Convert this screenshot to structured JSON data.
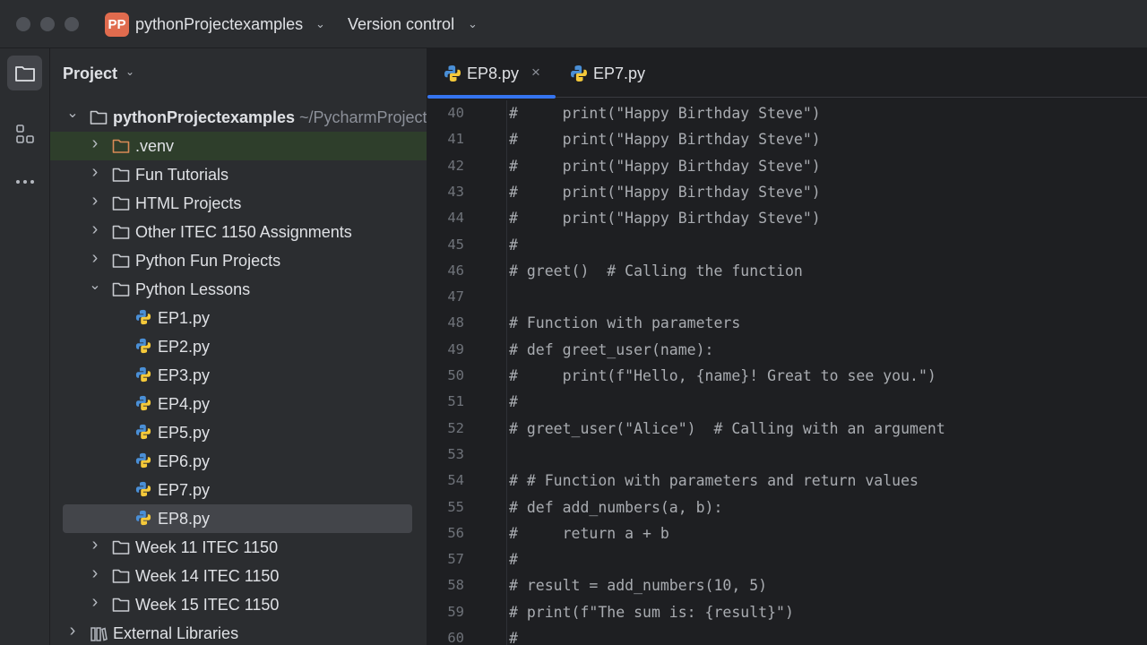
{
  "titlebar": {
    "project_badge": "PP",
    "project_name": "pythonProjectexamples",
    "vcs_label": "Version control"
  },
  "project_panel": {
    "header": "Project",
    "tree": [
      {
        "label": "pythonProjectexamples",
        "path": "~/PycharmProjects/pythonProjectexamples",
        "kind": "root-folder",
        "expanded": true
      },
      {
        "label": ".venv",
        "kind": "venv-folder",
        "expanded": false
      },
      {
        "label": "Fun Tutorials",
        "kind": "folder",
        "expanded": false
      },
      {
        "label": "HTML Projects",
        "kind": "folder",
        "expanded": false
      },
      {
        "label": "Other ITEC 1150 Assignments",
        "kind": "folder",
        "expanded": false
      },
      {
        "label": "Python Fun Projects",
        "kind": "folder",
        "expanded": false
      },
      {
        "label": "Python Lessons",
        "kind": "folder",
        "expanded": true
      },
      {
        "label": "EP1.py",
        "kind": "python-file"
      },
      {
        "label": "EP2.py",
        "kind": "python-file"
      },
      {
        "label": "EP3.py",
        "kind": "python-file"
      },
      {
        "label": "EP4.py",
        "kind": "python-file"
      },
      {
        "label": "EP5.py",
        "kind": "python-file"
      },
      {
        "label": "EP6.py",
        "kind": "python-file"
      },
      {
        "label": "EP7.py",
        "kind": "python-file"
      },
      {
        "label": "EP8.py",
        "kind": "python-file",
        "selected": true
      },
      {
        "label": "Week 11 ITEC 1150",
        "kind": "folder",
        "expanded": false
      },
      {
        "label": "Week 14 ITEC 1150",
        "kind": "folder",
        "expanded": false
      },
      {
        "label": "Week 15 ITEC 1150",
        "kind": "folder",
        "expanded": false
      },
      {
        "label": "External Libraries",
        "kind": "library",
        "expanded": false
      }
    ]
  },
  "editor": {
    "tabs": [
      {
        "label": "EP8.py",
        "active": true,
        "close_glyph": "×"
      },
      {
        "label": "EP7.py",
        "active": false
      }
    ],
    "lines": [
      {
        "n": "40",
        "text": "#     print(\"Happy Birthday Steve\")"
      },
      {
        "n": "41",
        "text": "#     print(\"Happy Birthday Steve\")"
      },
      {
        "n": "42",
        "text": "#     print(\"Happy Birthday Steve\")"
      },
      {
        "n": "43",
        "text": "#     print(\"Happy Birthday Steve\")"
      },
      {
        "n": "44",
        "text": "#     print(\"Happy Birthday Steve\")"
      },
      {
        "n": "45",
        "text": "#"
      },
      {
        "n": "46",
        "text": "# greet()  # Calling the function"
      },
      {
        "n": "47",
        "text": ""
      },
      {
        "n": "48",
        "text": "# Function with parameters"
      },
      {
        "n": "49",
        "text": "# def greet_user(name):"
      },
      {
        "n": "50",
        "text": "#     print(f\"Hello, {name}! Great to see you.\")"
      },
      {
        "n": "51",
        "text": "#"
      },
      {
        "n": "52",
        "text": "# greet_user(\"Alice\")  # Calling with an argument"
      },
      {
        "n": "53",
        "text": ""
      },
      {
        "n": "54",
        "text": "# # Function with parameters and return values"
      },
      {
        "n": "55",
        "text": "# def add_numbers(a, b):"
      },
      {
        "n": "56",
        "text": "#     return a + b"
      },
      {
        "n": "57",
        "text": "#"
      },
      {
        "n": "58",
        "text": "# result = add_numbers(10, 5)"
      },
      {
        "n": "59",
        "text": "# print(f\"The sum is: {result}\")"
      },
      {
        "n": "60",
        "text": "#"
      }
    ]
  },
  "colors": {
    "accent": "#3574f0",
    "project_badge": "#e06b4e",
    "venv_folder": "#d88a56",
    "venv_row": "#2e3e2b",
    "comment_text": "#a9acb1"
  },
  "icons": {
    "project_tool": "folder-icon",
    "structure_tool": "structure-icon",
    "more_tools": "more-icon",
    "python_file": "python-file-icon",
    "folder": "folder-icon",
    "library": "library-icon"
  }
}
